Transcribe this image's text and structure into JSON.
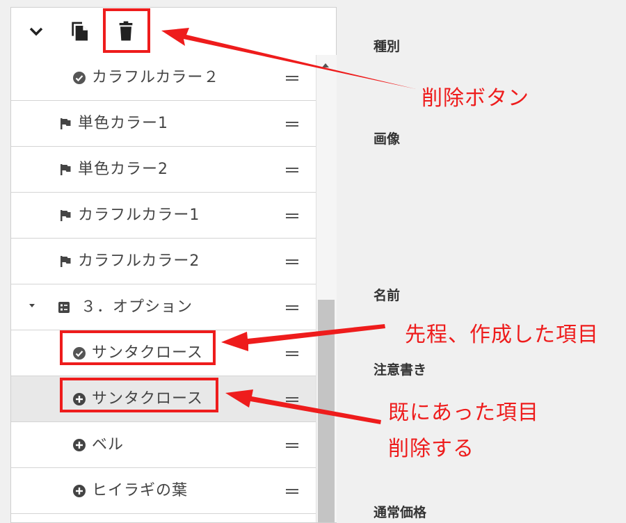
{
  "toolbar": {
    "collapse_icon": "chevron-down-icon",
    "copy_icon": "copy-icon",
    "delete_icon": "trash-icon"
  },
  "list": {
    "rows": [
      {
        "label": "カラフルカラー２",
        "icon": "check-circle-icon"
      },
      {
        "label": "単色カラー1",
        "icon": "flag-icon"
      },
      {
        "label": "単色カラー2",
        "icon": "flag-icon"
      },
      {
        "label": "カラフルカラー1",
        "icon": "flag-icon"
      },
      {
        "label": "カラフルカラー2",
        "icon": "flag-icon"
      },
      {
        "label": "３．オプション",
        "icon": "list-icon"
      },
      {
        "label": "サンタクロース",
        "icon": "check-circle-icon"
      },
      {
        "label": "サンタクロース",
        "icon": "plus-circle-icon"
      },
      {
        "label": "ベル",
        "icon": "plus-circle-icon"
      },
      {
        "label": "ヒイラギの葉",
        "icon": "plus-circle-icon"
      }
    ]
  },
  "form": {
    "labels": [
      "種別",
      "画像",
      "名前",
      "注意書き",
      "通常価格"
    ]
  },
  "annotations": {
    "delete_button": "削除ボタン",
    "created_item": "先程、作成した項目",
    "existing_line1": "既にあった項目",
    "existing_line2": "削除する"
  },
  "colors": {
    "annotation_red": "#ee1c1c",
    "highlight_row": "#e8e8e8",
    "icon_dark": "#444444"
  }
}
